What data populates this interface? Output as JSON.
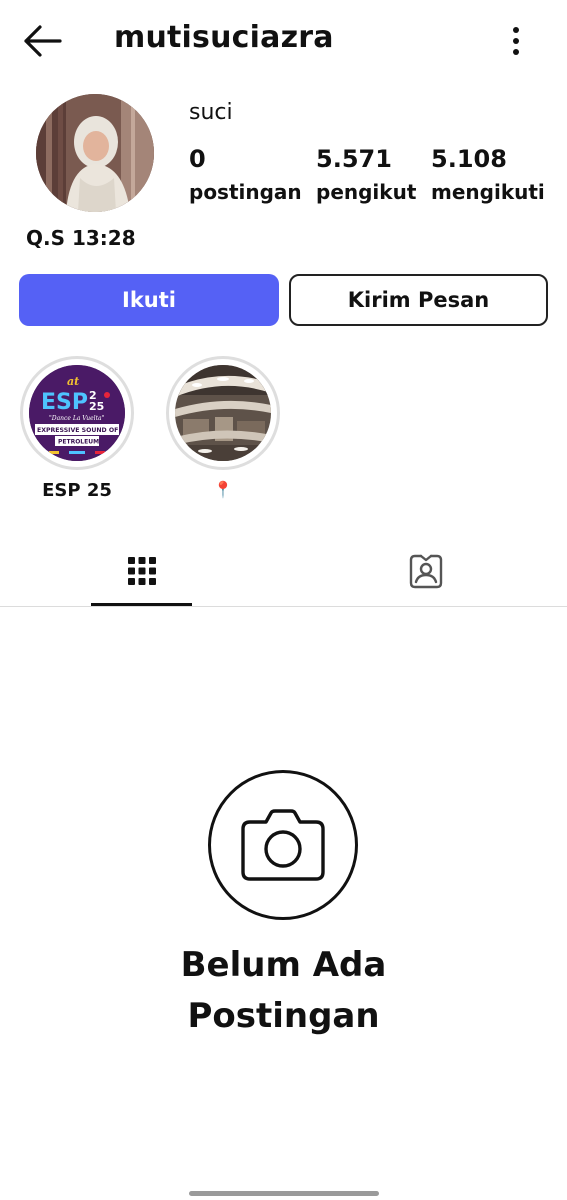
{
  "header": {
    "username": "mutisuciazra",
    "back_icon": "arrow-left-icon",
    "more_icon": "more-vertical-icon"
  },
  "profile": {
    "display_name": "suci",
    "bio": "Q.S 13:28",
    "stats": [
      {
        "value": "0",
        "label": "postingan"
      },
      {
        "value": "5.571",
        "label": "pengikut"
      },
      {
        "value": "5.108",
        "label": "mengikuti"
      }
    ]
  },
  "actions": {
    "follow_label": "Ikuti",
    "message_label": "Kirim Pesan"
  },
  "highlights": [
    {
      "label": "ESP 25",
      "cover_text": [
        "at",
        "ESP",
        "2",
        "25",
        "\"Dance La Vuelta\"",
        "EXPRESSIVE SOUND OF",
        "PETROLEUM"
      ]
    },
    {
      "label": "📍"
    }
  ],
  "tabs": [
    {
      "name": "posts-grid",
      "icon": "grid-icon",
      "active": true
    },
    {
      "name": "tagged",
      "icon": "tagged-user-icon",
      "active": false
    }
  ],
  "empty_state": {
    "icon": "camera-icon",
    "title": "Belum Ada Postingan"
  },
  "colors": {
    "accent": "#5561f5",
    "text": "#111111",
    "divider": "#dcdcdc"
  }
}
